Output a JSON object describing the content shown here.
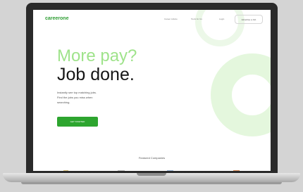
{
  "site": {
    "logo": "careerone",
    "nav": {
      "items": [
        "Career Advice",
        "Tools for Us",
        "Login"
      ],
      "cta": "Advertise a Job"
    },
    "hero": {
      "headline_a": "More pay?",
      "headline_b": "Job done.",
      "copy_lines": [
        "Instantly see top matching jobs.",
        "Find the jobs you miss when",
        "searching."
      ],
      "cta_label": "GET STARTED"
    },
    "featured": {
      "title": "Featured Companies"
    }
  },
  "colors": {
    "brand": "#2f9e34",
    "accent_light": "#9fe38b",
    "ring": "#e4f7dd"
  }
}
